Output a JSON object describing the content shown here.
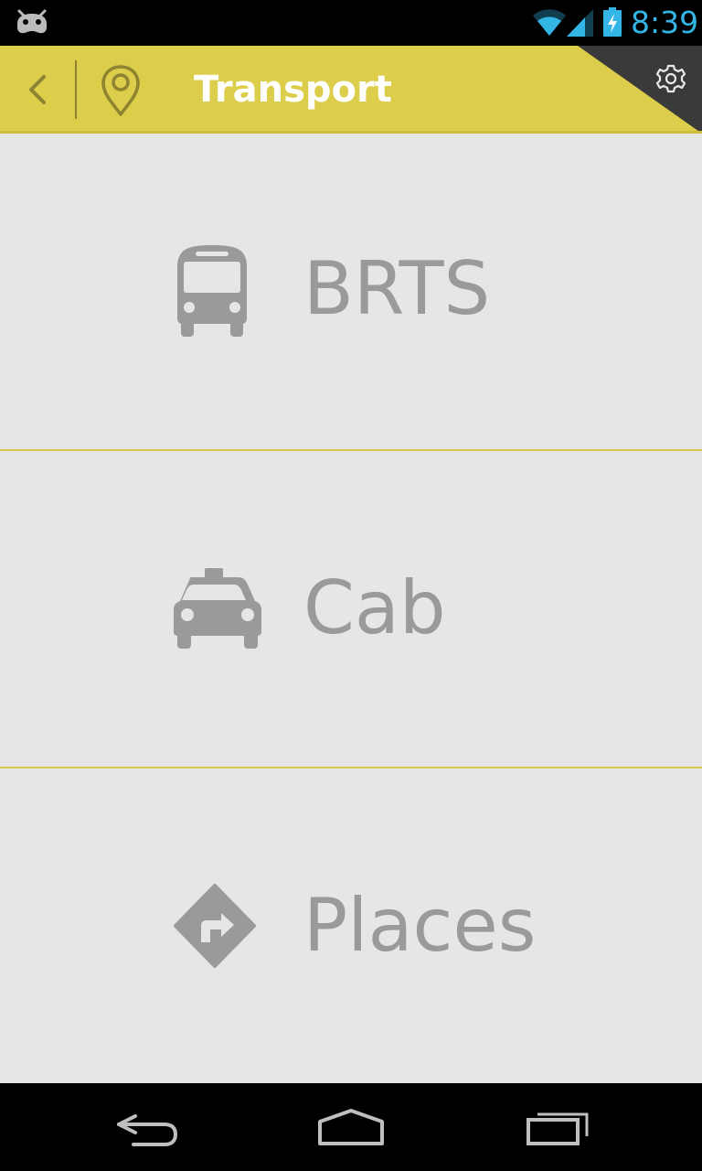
{
  "status_bar": {
    "time": "8:39",
    "icons": [
      "android-icon",
      "wifi-icon",
      "signal-icon",
      "battery-icon"
    ],
    "time_color": "#33b5e5"
  },
  "action_bar": {
    "title": "Transport",
    "background_color": "#dccd4a",
    "icons": [
      "back-icon",
      "location-pin-icon",
      "settings-icon"
    ]
  },
  "menu": {
    "items": [
      {
        "label": "BRTS",
        "icon": "bus-icon"
      },
      {
        "label": "Cab",
        "icon": "taxi-icon"
      },
      {
        "label": "Places",
        "icon": "directions-icon"
      }
    ],
    "text_color": "#9a9a9a",
    "separator_color": "#d8c94a"
  },
  "nav_bar": {
    "icons": [
      "nav-back-icon",
      "nav-home-icon",
      "nav-recents-icon"
    ]
  }
}
